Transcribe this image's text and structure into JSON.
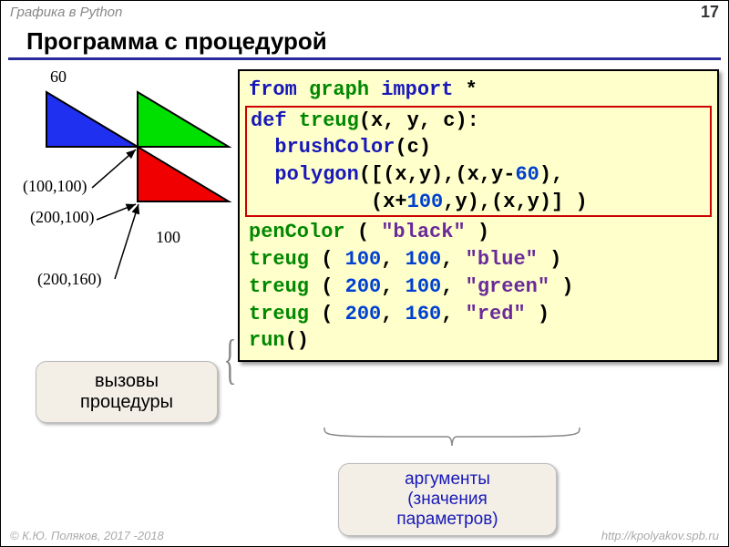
{
  "header": {
    "subject": "Графика в Python",
    "page": "17"
  },
  "title": "Программа с процедурой",
  "diagram": {
    "top_label": "60",
    "bottom_label": "100",
    "points": [
      "(100,100)",
      "(200,100)",
      "(200,160)"
    ]
  },
  "code": {
    "l1_from": "from",
    "l1_mod": "graph",
    "l1_import": "import",
    "l1_star": "*",
    "l2_def": "def",
    "l2_name": "treug",
    "l2_args": "(x, y, c):",
    "l3_fn": "brushColor",
    "l3_c": "(c)",
    "l4_fn": "polygon",
    "l4_a": "([(x,y),(x,y-",
    "l4_n": "60",
    "l4_b": "),",
    "l5_a": "(x+",
    "l5_n": "100",
    "l5_b": ",y),(x,y)] )",
    "l6_fn": "penColor",
    "l6_a": " ( ",
    "l6_s": "\"black\"",
    "l6_b": " )",
    "l7_fn": "treug",
    "l7_a": " ( ",
    "l7_n1": "100",
    "l7_c": ", ",
    "l7_n2": "100",
    "l7_d": ", ",
    "l7_s": "\"blue\"",
    "l7_e": " )",
    "l8_fn": "treug",
    "l8_a": " ( ",
    "l8_n1": "200",
    "l8_c": ", ",
    "l8_n2": "100",
    "l8_d": ", ",
    "l8_s": "\"green\"",
    "l8_e": " )",
    "l9_fn": "treug",
    "l9_a": " ( ",
    "l9_n1": "200",
    "l9_c": ", ",
    "l9_n2": "160",
    "l9_d": ", ",
    "l9_s": "\"red\"",
    "l9_e": " )",
    "l10_fn": "run",
    "l10_p": "()"
  },
  "callouts": {
    "calls_l1": "вызовы",
    "calls_l2": "процедуры",
    "args_l1": "аргументы",
    "args_l2": "(значения",
    "args_l3": "параметров)"
  },
  "footer": {
    "left": "© К.Ю. Поляков, 2017 -2018",
    "right": "http://kpolyakov.spb.ru"
  }
}
